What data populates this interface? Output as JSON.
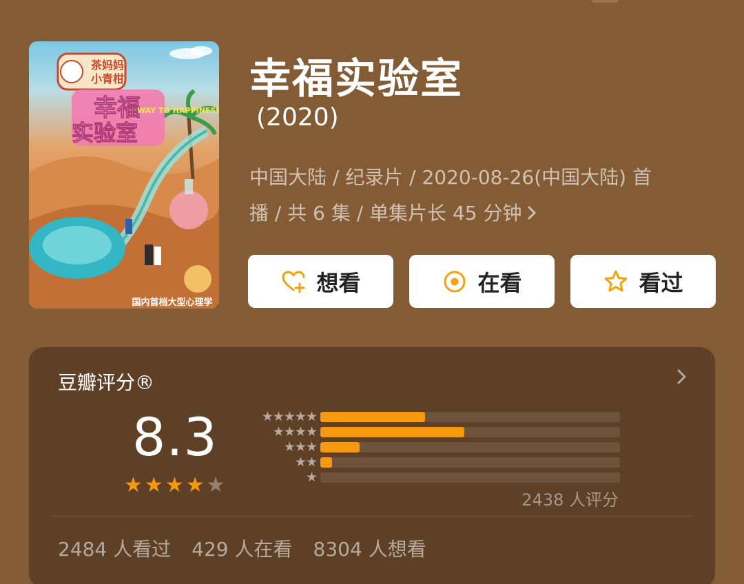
{
  "movie": {
    "title": "幸福实验室",
    "year": "(2020)",
    "meta_line1": "中国大陆 / 纪录片 / 2020-08-26(中国大陆) 首",
    "meta_line2": "播 / 共 6 集 / 单集片长 45 分钟",
    "poster": {
      "badge_line1": "茶妈妈",
      "badge_line2": "小青柑",
      "logo_line1": "幸福",
      "logo_line2": "实验室",
      "english": "WAY TO HAPPINESS",
      "bottom_caption": "国内首档大型心理学"
    }
  },
  "actions": [
    {
      "label": "想看",
      "icon": "heart-plus-icon"
    },
    {
      "label": "在看",
      "icon": "target-circle-icon"
    },
    {
      "label": "看过",
      "icon": "star-outline-icon"
    }
  ],
  "rating": {
    "label": "豆瓣评分®",
    "score": "8.3",
    "stars_filled": 4,
    "stars_total": 5,
    "distribution": [
      {
        "stars": 5,
        "fraction": 0.35
      },
      {
        "stars": 4,
        "fraction": 0.48
      },
      {
        "stars": 3,
        "fraction": 0.13
      },
      {
        "stars": 2,
        "fraction": 0.04
      },
      {
        "stars": 1,
        "fraction": 0.0
      }
    ],
    "count_text": "2438 人评分"
  },
  "stats": {
    "watched": "2484 人看过",
    "watching": "429 人在看",
    "want": "8304 人想看"
  },
  "colors": {
    "background": "#835c35",
    "card": "#5e4026",
    "accent": "#f59a0f",
    "button_bg": "#ffffff"
  }
}
